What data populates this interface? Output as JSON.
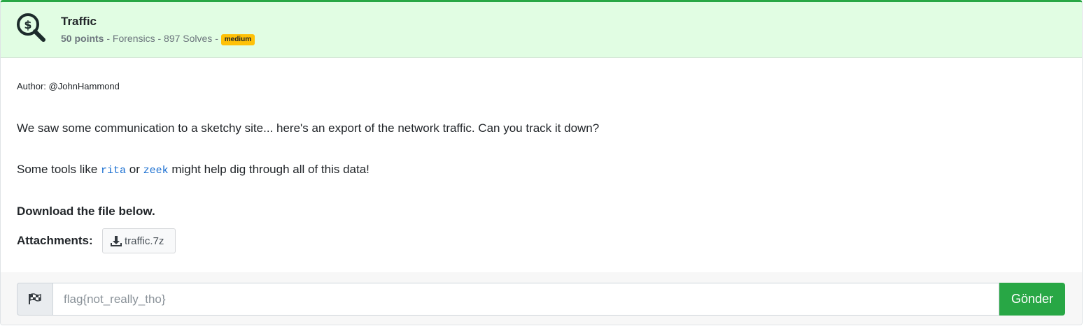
{
  "challenge": {
    "title": "Traffic",
    "points": "50 points",
    "meta_rest": " - Forensics - 897 Solves - ",
    "difficulty": "medium",
    "icon": "magnifier-dollar-icon",
    "header_bg": "#e1fde3",
    "accent": "#28a745",
    "badge_color": "#ffc107"
  },
  "body": {
    "author": "Author: @JohnHammond",
    "description": "We saw some communication to a sketchy site... here's an export of the network traffic. Can you track it down?",
    "tools_prefix": "Some tools like ",
    "tool_1": "rita",
    "tools_mid": " or ",
    "tool_2": "zeek",
    "tools_suffix": " might help dig through all of this data!",
    "download_text": "Download the file below.",
    "attachments_label": "Attachments:",
    "attachment_file": "traffic.7z"
  },
  "submit": {
    "placeholder": "flag{not_really_tho}",
    "button_label": "Gönder",
    "addon_icon": "checkered-flag-icon"
  }
}
